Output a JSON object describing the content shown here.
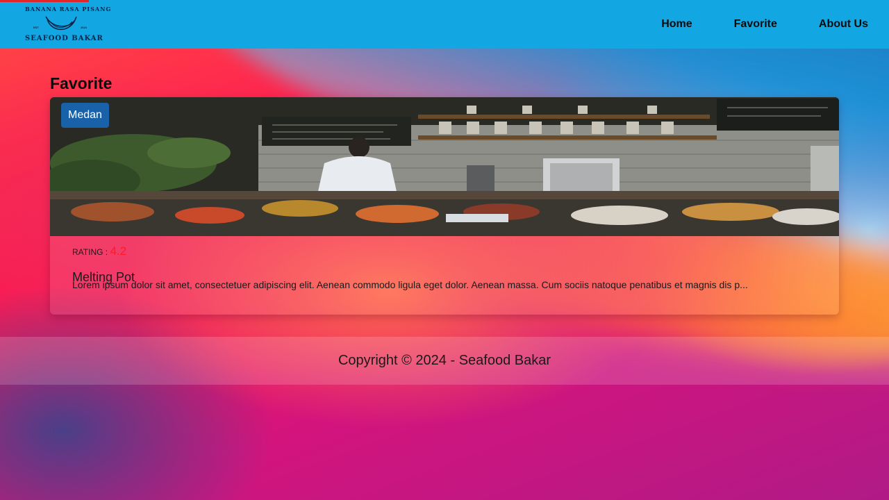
{
  "header": {
    "logo": {
      "top_text": "BANANA RASA PISANG",
      "bottom_text": "SEAFOOD BAKAR",
      "year_left": "EST",
      "year_right": "2024"
    },
    "nav": [
      "Home",
      "Favorite",
      "About Us"
    ]
  },
  "main": {
    "title": "Favorite",
    "restaurants": [
      {
        "city": "Medan",
        "rating_label": "RATING :",
        "rating": "4.2",
        "name": "Melting Pot",
        "description": "Lorem ipsum dolor sit amet, consectetuer adipiscing elit. Aenean commodo ligula eget dolor. Aenean massa. Cum sociis natoque penatibus et magnis dis p..."
      }
    ]
  },
  "footer": {
    "copyright": "Copyright © 2024 - Seafood Bakar"
  },
  "colors": {
    "header": "#12a6e2",
    "badge": "#1962a9",
    "rating_value": "#ff1a2a"
  }
}
